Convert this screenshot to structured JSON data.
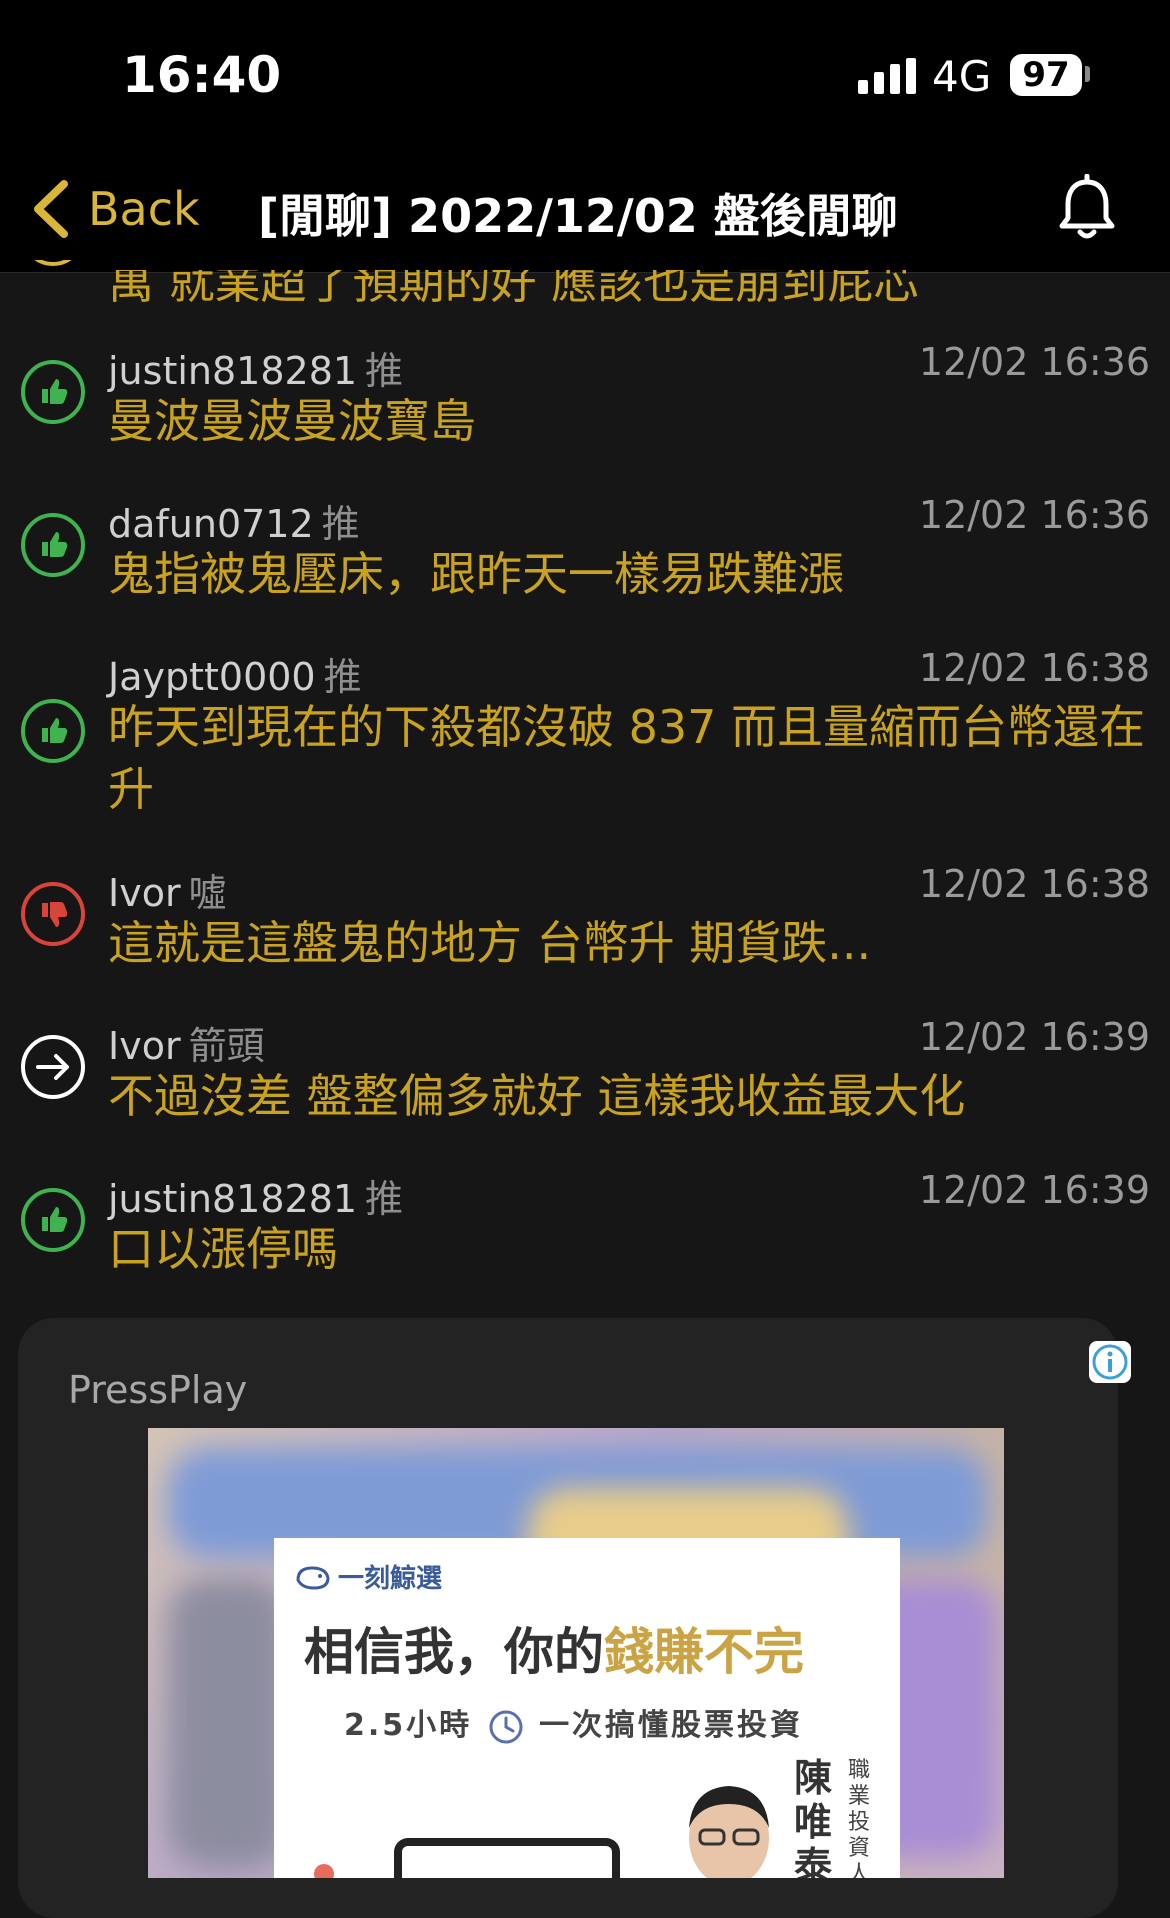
{
  "status_bar": {
    "time": "16:40",
    "network": "4G",
    "battery": "97"
  },
  "nav": {
    "back_label": "Back",
    "title": "[閒聊] 2022/12/02 盤後閒聊"
  },
  "partial_comment": {
    "text": "萬 就業超了預期的好 應該也是崩到屁芯"
  },
  "comments": [
    {
      "user": "justin818281",
      "tag": "推",
      "time": "12/02 16:36",
      "text": "曼波曼波曼波寶島",
      "type": "push"
    },
    {
      "user": "dafun0712",
      "tag": "推",
      "time": "12/02 16:36",
      "text": "鬼指被鬼壓床，跟昨天一樣易跌難漲",
      "type": "push"
    },
    {
      "user": "Jayptt0000",
      "tag": "推",
      "time": "12/02 16:38",
      "text": "昨天到現在的下殺都沒破 837 而且量縮而台幣還在升",
      "type": "push"
    },
    {
      "user": "Ivor",
      "tag": "噓",
      "time": "12/02 16:38",
      "text": "這就是這盤鬼的地方 台幣升 期貨跌...",
      "type": "boo"
    },
    {
      "user": "Ivor",
      "tag": "箭頭",
      "time": "12/02 16:39",
      "text": "不過沒差 盤整偏多就好 這樣我收益最大化",
      "type": "arrow"
    },
    {
      "user": "justin818281",
      "tag": "推",
      "time": "12/02 16:39",
      "text": "口以漲停嗎",
      "type": "push"
    }
  ],
  "ad": {
    "sponsor": "PressPlay",
    "brand": "一刻鯨選",
    "headline_a": "相信我，你的",
    "headline_b": "錢賺不完",
    "subline_a": "2.5小時",
    "subline_b": "一次搞懂股票投資",
    "person_name": "陳唯泰",
    "person_title": "職業投資人"
  },
  "colors": {
    "accent": "#d9b53a",
    "comment_text": "#c9a31f",
    "push": "#3fb34f",
    "boo": "#d9443a",
    "arrow": "#ffffff"
  }
}
